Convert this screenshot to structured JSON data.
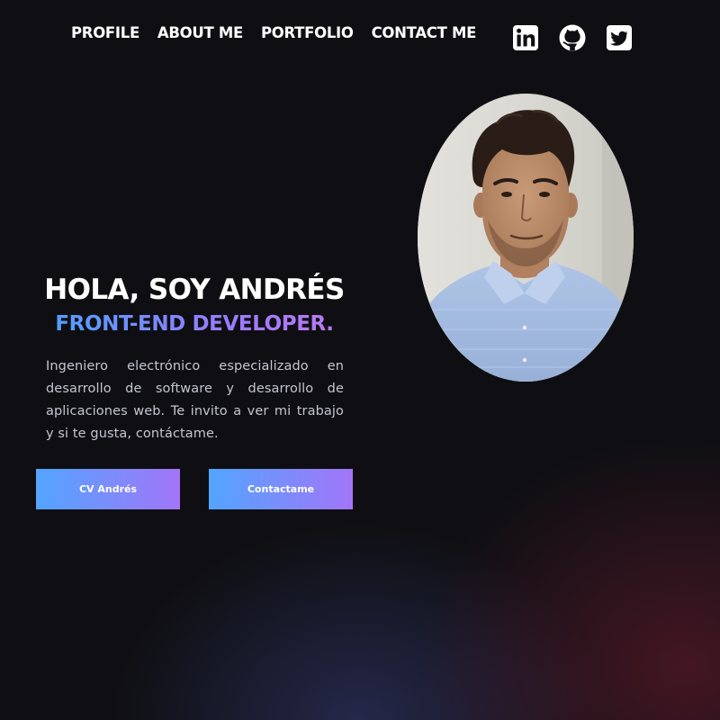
{
  "nav": {
    "items": [
      "PROFILE",
      "ABOUT ME",
      "PORTFOLIO",
      "CONTACT ME"
    ]
  },
  "socials": [
    {
      "icon": "linkedin-icon"
    },
    {
      "icon": "github-icon"
    },
    {
      "icon": "twitter-icon"
    }
  ],
  "hero": {
    "title": "HOLA, SOY ANDRÉS",
    "subtitle": "FRONT-END DEVELOPER.",
    "description": "Ingeniero electrónico especializado en desarrollo de software y desarrollo de aplicaciones web. Te invito a ver mi trabajo y si te gusta, contáctame."
  },
  "buttons": {
    "cv_label": "CV Andrés",
    "contact_label": "Contactame"
  },
  "colors": {
    "background": "#0f0f13",
    "accent_blue": "#52a5ff",
    "accent_purple": "#a275f7",
    "glow_red": "#6e1c30",
    "glow_navy": "#2c305c"
  }
}
